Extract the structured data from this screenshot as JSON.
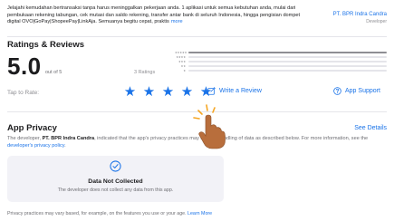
{
  "description": {
    "text": "Jelajahi kemudahan bertransaksi tanpa harus meninggalkan pekerjaan anda. 1 aplikasi untuk semua kebutuhan anda, mulai dari pembukaan rekening tabungan, cek mutasi dan saldo rekening, transfer antar bank di seluruh Indonesia, hingga pengisian dompet digital OVO|GoPay|ShopeePay|LinkAja. Semuanya begitu cepat, praktis",
    "more_label": "more",
    "developer_name": "PT. BPR Indra Candra",
    "developer_label": "Developer"
  },
  "ratings": {
    "title": "Ratings & Reviews",
    "score": "5.0",
    "out_of": "out of 5",
    "count": "3 Ratings",
    "tap_to_rate": "Tap to Rate:",
    "write_review": "Write a Review",
    "app_support": "App Support",
    "star_levels": [
      "★★★★★",
      "★★★★",
      "★★★",
      "★★",
      "★"
    ],
    "distribution": [
      1.0,
      0,
      0,
      0,
      0
    ],
    "user_stars": 5,
    "accent_color": "#1a73e8"
  },
  "privacy": {
    "title": "App Privacy",
    "see_details": "See Details",
    "text_before_dev": "The developer, ",
    "developer": "PT. BPR Indra Candra",
    "text_mid": ", indicated that the app's privacy practices may include handling of data as described below. For more information, see the ",
    "policy_link": "developer's privacy policy",
    "text_end": ".",
    "card_title": "Data Not Collected",
    "card_sub": "The developer does not collect any data from this app.",
    "footer_text": "Privacy practices may vary based, for example, on the features you use or your age. ",
    "footer_link": "Learn More"
  },
  "icons": {
    "star": "star-icon",
    "write": "compose-icon",
    "support": "question-circle-icon",
    "check": "checkmark-circle-icon",
    "hand": "tap-hand-icon"
  }
}
